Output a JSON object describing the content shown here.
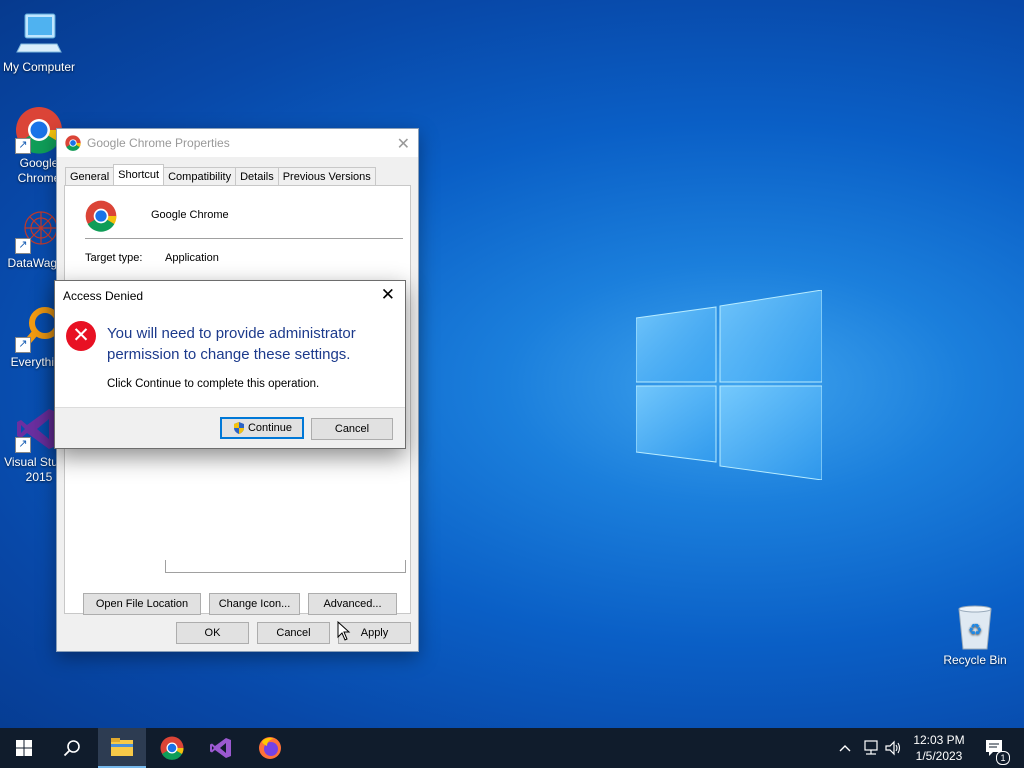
{
  "desktop": {
    "icons": [
      {
        "label": "My Computer"
      },
      {
        "label": "Google Chrome"
      },
      {
        "label": "DataWagon"
      },
      {
        "label": "Everything"
      },
      {
        "label": "Visual Studio 2015"
      },
      {
        "label": "Recycle Bin"
      }
    ]
  },
  "properties_window": {
    "title": "Google Chrome Properties",
    "tabs": [
      "General",
      "Shortcut",
      "Compatibility",
      "Details",
      "Previous Versions"
    ],
    "active_tab": "Shortcut",
    "app_name": "Google Chrome",
    "target_type_label": "Target type:",
    "target_type_value": "Application",
    "buttons": {
      "open_file_location": "Open File Location",
      "change_icon": "Change Icon...",
      "advanced": "Advanced...",
      "ok": "OK",
      "cancel": "Cancel",
      "apply": "Apply"
    }
  },
  "access_denied_dialog": {
    "title": "Access Denied",
    "main_instruction": "You will need to provide administrator permission to change these settings.",
    "content": "Click Continue to complete this operation.",
    "continue_label": "Continue",
    "cancel_label": "Cancel"
  },
  "taskbar": {
    "time": "12:03 PM",
    "date": "1/5/2023",
    "notification_count": "1"
  },
  "colors": {
    "accent": "#0078d7",
    "error": "#e81123",
    "instruction_text": "#1c3a8c",
    "taskbar": "#101c2c"
  }
}
